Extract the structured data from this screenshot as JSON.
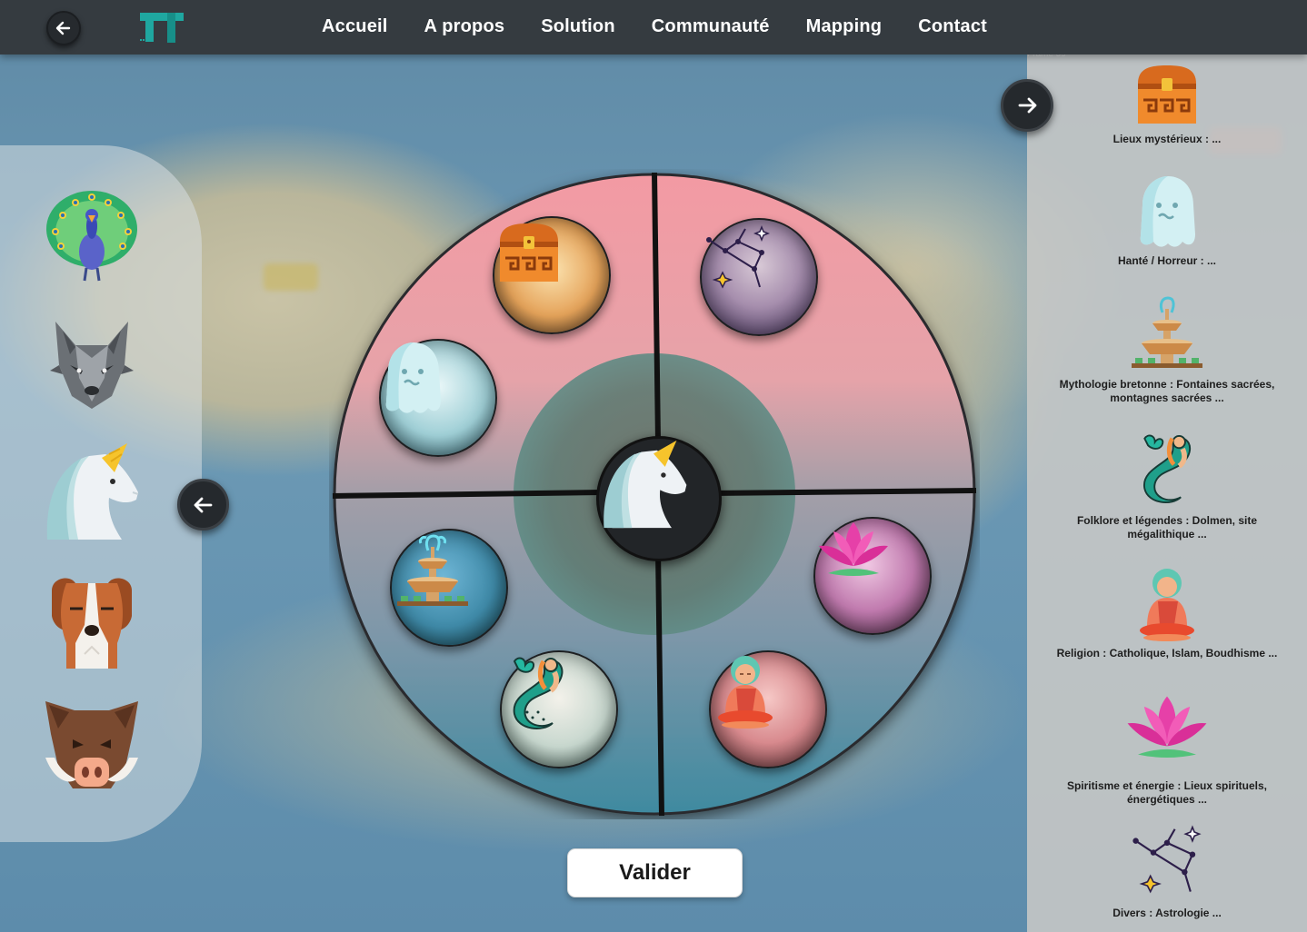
{
  "nav": {
    "items": [
      {
        "label": "Accueil"
      },
      {
        "label": "A propos"
      },
      {
        "label": "Solution"
      },
      {
        "label": "Communauté"
      },
      {
        "label": "Mapping"
      },
      {
        "label": "Contact"
      }
    ]
  },
  "left_panel": {
    "animals": [
      "peacock-icon",
      "wolf-icon",
      "unicorn-icon",
      "dog-icon",
      "boar-icon"
    ]
  },
  "right_panel": {
    "frame_label": "Frame 59",
    "categories": [
      {
        "icon": "treasure-chest-icon",
        "label": "Lieux mystérieux :  ..."
      },
      {
        "icon": "ghost-icon",
        "label": "Hanté / Horreur : ..."
      },
      {
        "icon": "fountain-icon",
        "label": "Mythologie bretonne : Fontaines sacrées, montagnes sacrées ..."
      },
      {
        "icon": "mermaid-icon",
        "label": "Folklore et légendes : Dolmen, site mégalithique ..."
      },
      {
        "icon": "monk-icon",
        "label": "Religion : Catholique, Islam, Boudhisme ..."
      },
      {
        "icon": "lotus-icon",
        "label": "Spiritisme et énergie : Lieux spirituels, énergétiques ..."
      },
      {
        "icon": "constellation-icon",
        "label": "Divers : Astrologie ..."
      }
    ]
  },
  "wheel": {
    "center_icon": "unicorn-icon",
    "options": [
      "treasure-chest-icon",
      "constellation-icon",
      "ghost-icon",
      "lotus-icon",
      "fountain-icon",
      "mermaid-icon",
      "monk-icon"
    ]
  },
  "actions": {
    "validate_label": "Valider"
  },
  "colors": {
    "header": "#353b40",
    "accent_teal": "#1fa7a0",
    "wheel_pink": "#f19aa3",
    "wheel_blue": "#5d8fa6"
  }
}
